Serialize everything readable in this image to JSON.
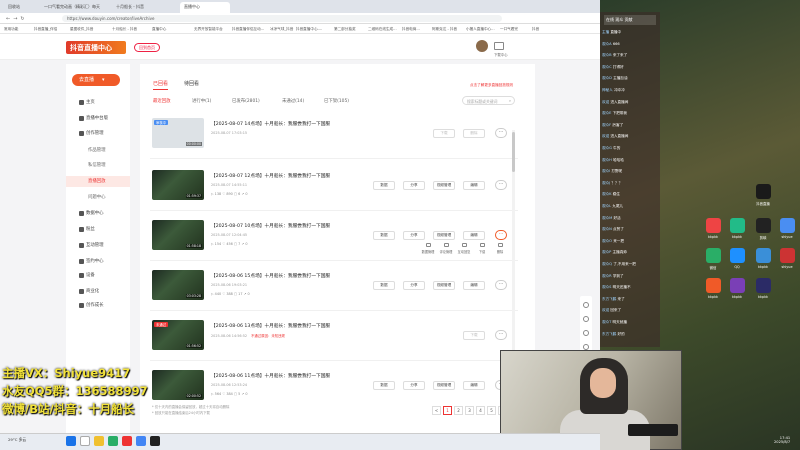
{
  "browser": {
    "tabs": [
      "回收站",
      "一口气看完动画（精彩汇）每天",
      "十月船长 - 抖音",
      "直播中心"
    ],
    "url": "https://www.douyin.com/creator/liveArchive",
    "bookmarks": [
      "常用功能",
      "抖音直播_伴侣",
      "星图收件_抖音",
      "十月船长 - 抖音",
      "直播中心",
      "无界开放智能平台",
      "抖音直播伴侣互动...",
      "冰凉气球_抖音",
      "抖音直播中心-...",
      "第二部分抽奖",
      "二维码在线生成...",
      "抖音电商...",
      "阿斯克达 - 抖音",
      "小猪人直播中心...",
      "一口气看完",
      "抖音"
    ]
  },
  "site": {
    "logo_text": "抖音直播中心",
    "upload_label": "回到首页",
    "user_label": "下载中心"
  },
  "sidebar": {
    "live_button": "去直播",
    "items": [
      "主页",
      "直播中台版",
      "创作管理",
      "作品管理",
      "私信管理",
      "直播回放",
      "问题中心",
      "数据中心",
      "粉丝",
      "互动管理",
      "签约中心",
      "设备",
      "商业化",
      "创作成长"
    ]
  },
  "main": {
    "tabs": [
      "已回看",
      "待回看"
    ],
    "filters": [
      "最近回放",
      "进行中(1)",
      "已发布(2801)",
      "未通过(14)",
      "已下架(105)"
    ],
    "search_placeholder": "搜索标题或关键词",
    "top_link": "点击了解更多直播回放规则",
    "rows": [
      {
        "title": "【2025-08-07 14点场】十月船长：我服尝我打一下国服",
        "time": "2025-08-07 17:03:15",
        "stats": "",
        "badge": "审核中",
        "badge_color": "#4a8ef2",
        "duration": "00:00:00",
        "pending": true,
        "buttons": [
          "下载",
          "删除"
        ],
        "disabled": true
      },
      {
        "title": "【2025-08-07 12点场】十月船长：我服尝我打一下国服",
        "time": "2025-08-07 14:55:11",
        "stats": "▷ 138   ♡ 890   ▢ 6   ↗ 0",
        "badge": "",
        "badge_color": "",
        "duration": "01:59:37",
        "pending": false,
        "buttons": [
          "数据",
          "分享",
          "视频管理",
          "编辑"
        ],
        "disabled": false
      },
      {
        "title": "【2025-08-07 10点场】十月船长：我服尝我打一下国服",
        "time": "2025-08-07 12:04:45",
        "stats": "▷ 154   ♡ 456   ▢ 7   ↗ 0",
        "badge": "",
        "badge_color": "",
        "duration": "01:58:18",
        "pending": false,
        "buttons": [
          "数据",
          "分享",
          "视频管理",
          "编辑"
        ],
        "disabled": false
      },
      {
        "title": "【2025-08-06 15点场】十月船长：我服尝我打一下国服",
        "time": "2025-08-06 19:03:21",
        "stats": "▷ 440   ♡ 388   ▢ 17   ↗ 0",
        "badge": "",
        "badge_color": "",
        "duration": "03:03:28",
        "pending": false,
        "buttons": [
          "数据",
          "分享",
          "视频管理",
          "编辑"
        ],
        "disabled": false
      },
      {
        "title": "【2025-08-06 13点场】十月船长：我服尝我打一下国服",
        "time": "2025-08-06 14:56:52",
        "warn": "不通过原因：未知违规",
        "stats": "",
        "badge": "未通过",
        "badge_color": "#e33",
        "duration": "01:56:52",
        "pending": false,
        "buttons": [
          "下载"
        ],
        "disabled": true
      },
      {
        "title": "【2025-08-06 11点场】十月船长：我服尝我打一下国服",
        "time": "2025-08-06 12:53:24",
        "stats": "▷ 564   ♡ 384   ▢ 5   ↗ 0",
        "badge": "",
        "badge_color": "",
        "duration": "02:00:52",
        "pending": false,
        "buttons": [
          "数据",
          "分享",
          "视频管理",
          "编辑"
        ],
        "disabled": false
      }
    ],
    "hover_actions": [
      "数据管理",
      "评论管理",
      "互动回复",
      "下载",
      "删除"
    ],
    "notes": [
      "* 仅十天内的直播会保留回放，超过十天将自动删除",
      "* 回放只能在直播结束后24小时内下载"
    ],
    "pages": [
      "<",
      "1",
      "2",
      "3",
      "4",
      "5",
      ">"
    ],
    "active_page": "1"
  },
  "chat": {
    "header": "在线 观众 贡献",
    "lines": [
      {
        "u": "主播",
        "t": "直播中"
      },
      {
        "u": "观众A",
        "t": "666"
      },
      {
        "u": "观众B",
        "t": "来了来了"
      },
      {
        "u": "观众C",
        "t": "打得好"
      },
      {
        "u": "观众D",
        "t": "主播加油"
      },
      {
        "u": "神秘人",
        "t": "冲冲冲"
      },
      {
        "u": "欢迎",
        "t": "进入直播间"
      },
      {
        "u": "观众E",
        "t": "下把带我"
      },
      {
        "u": "观众F",
        "t": "厉害了"
      },
      {
        "u": "欢迎",
        "t": "进入直播间"
      },
      {
        "u": "观众G",
        "t": "牛的"
      },
      {
        "u": "观众H",
        "t": "哈哈哈"
      },
      {
        "u": "观众I",
        "t": "打野呢"
      },
      {
        "u": "观众J",
        "t": "？？？"
      },
      {
        "u": "观众K",
        "t": "稳住"
      },
      {
        "u": "观众L",
        "t": "九尾儿"
      },
      {
        "u": "观众M",
        "t": "好活"
      },
      {
        "u": "观众N",
        "t": "点赞了"
      },
      {
        "u": "观众O",
        "t": "来一把"
      },
      {
        "u": "观众P",
        "t": "主播真帅"
      },
      {
        "u": "观众Q",
        "t": "了,不用来一把"
      },
      {
        "u": "观众R",
        "t": "学到了"
      },
      {
        "u": "观众S",
        "t": "明天还播不"
      },
      {
        "u": "东方飞鹤",
        "t": "来了"
      },
      {
        "u": "欢迎",
        "t": "回来了"
      },
      {
        "u": "观众T",
        "t": "明天就播"
      },
      {
        "u": "东方飞鹤",
        "t": "好的"
      }
    ]
  },
  "desktop_icons": [
    {
      "label": "抖音直播",
      "color": "#1a1a1a"
    },
    {
      "label": "kkpkk",
      "color": "#e44"
    },
    {
      "label": "kkpkk",
      "color": "#2b8"
    },
    {
      "label": "剪映",
      "color": "#222"
    },
    {
      "label": "shiyue",
      "color": "#4a8ef2"
    },
    {
      "label": "微信",
      "color": "#2aae67"
    },
    {
      "label": "QQ",
      "color": "#1e90ff"
    },
    {
      "label": "kkpkk",
      "color": "#3a8fd8"
    },
    {
      "label": "shiyue",
      "color": "#c33"
    },
    {
      "label": "kkpkk",
      "color": "#f05a28"
    },
    {
      "label": "kkpkk",
      "color": "#7a3fb6"
    },
    {
      "label": "kkpkk",
      "color": "#2b2b66"
    }
  ],
  "overlay": {
    "line1": "主播VX：Shiyue9417",
    "line2": "水友QQ5群：136588997",
    "line3": "微博/B站/抖音：十月船长"
  },
  "taskbar": {
    "weather": "29°C 多云",
    "time": "17:41",
    "date": "2025/8/7"
  }
}
